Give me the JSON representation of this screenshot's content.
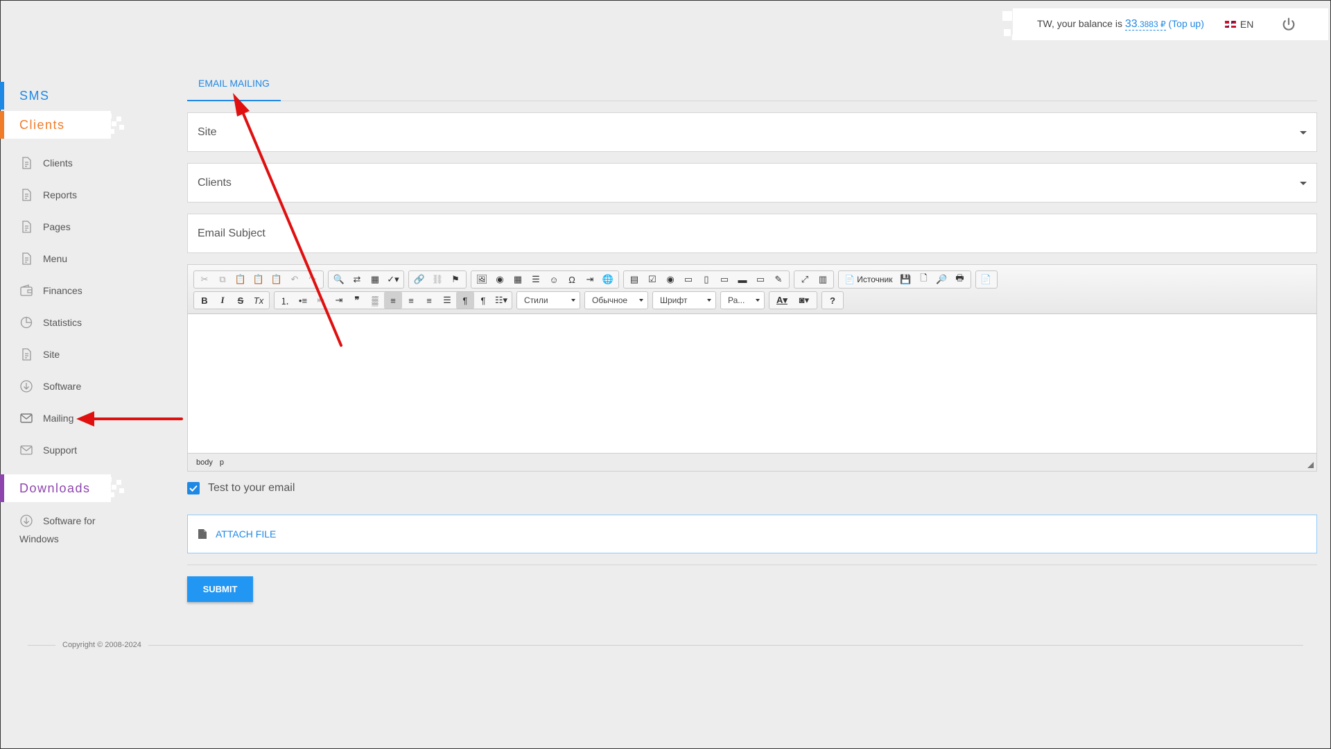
{
  "header": {
    "balance_prefix": "TW, your balance is",
    "balance_int": "33",
    "balance_frac": ".3883 ₽",
    "topup_label": "(Top up)",
    "language": "EN"
  },
  "sidebar": {
    "sections": {
      "sms": "SMS",
      "clients": "Clients",
      "downloads": "Downloads"
    },
    "items": [
      {
        "label": "Clients",
        "icon": "document-icon"
      },
      {
        "label": "Reports",
        "icon": "document-icon"
      },
      {
        "label": "Pages",
        "icon": "document-icon"
      },
      {
        "label": "Menu",
        "icon": "document-icon"
      },
      {
        "label": "Finances",
        "icon": "wallet-icon"
      },
      {
        "label": "Statistics",
        "icon": "pie-chart-icon"
      },
      {
        "label": "Site",
        "icon": "document-icon"
      },
      {
        "label": "Software",
        "icon": "download-icon"
      },
      {
        "label": "Mailing",
        "icon": "envelope-icon"
      },
      {
        "label": "Support",
        "icon": "envelope-icon"
      }
    ],
    "downloads_item_line1": "Software for",
    "downloads_item_line2": "Windows"
  },
  "main": {
    "tab_label": "EMAIL MAILING",
    "site_select": "Site",
    "clients_select": "Clients",
    "subject_placeholder": "Email Subject",
    "editor": {
      "source_label": "Источник",
      "styles_combo": "Стили",
      "format_combo": "Обычное",
      "font_combo": "Шрифт",
      "size_combo": "Ра...",
      "path_body": "body",
      "path_p": "p"
    },
    "test_checkbox_label": "Test to your email",
    "test_checkbox_checked": true,
    "attach_label": "ATTACH FILE",
    "submit_label": "SUBMIT"
  },
  "footer": {
    "copyright": "Copyright © 2008-2024"
  },
  "colors": {
    "accent": "#1e88e5",
    "clients": "#f07c2a",
    "downloads": "#8e44ad",
    "annotation_arrow": "#e01010"
  }
}
